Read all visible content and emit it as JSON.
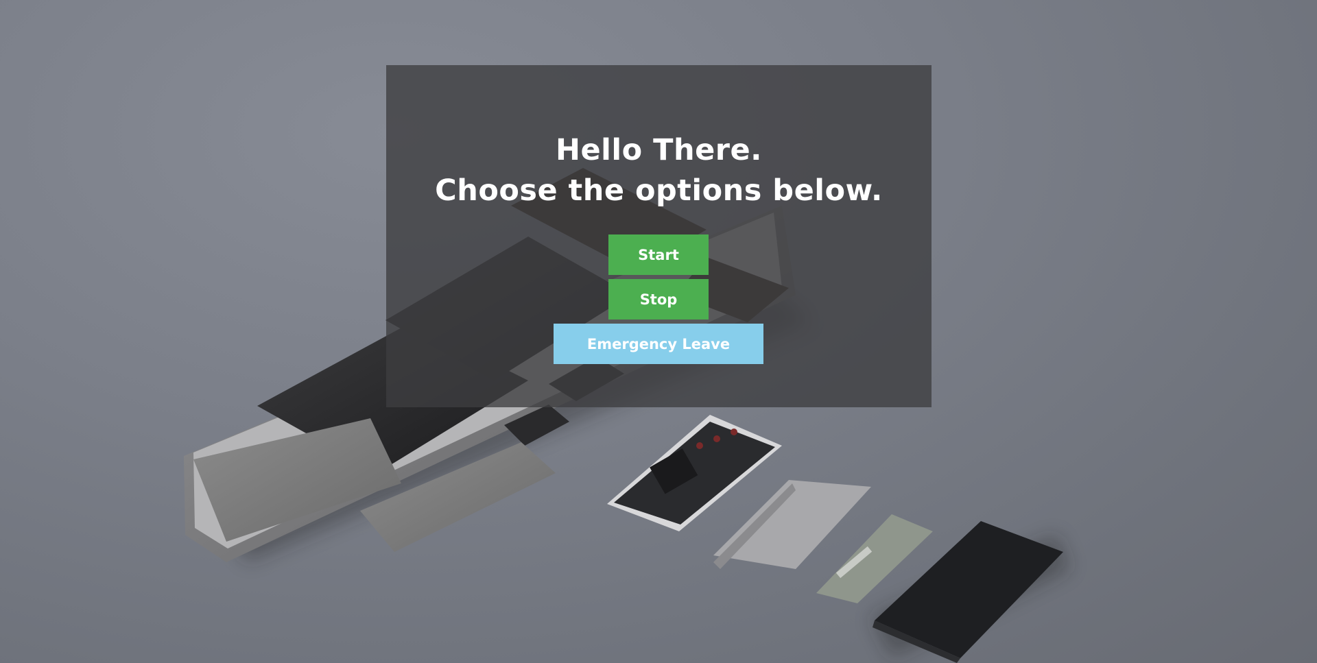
{
  "dialog": {
    "heading_line1": "Hello There.",
    "heading_line2": "Choose the options below."
  },
  "buttons": {
    "start_label": "Start",
    "stop_label": "Stop",
    "emergency_label": "Emergency Leave"
  },
  "colors": {
    "primary_button": "#4caf50",
    "emergency_button": "#87ceeb",
    "panel_overlay": "#3e3e40"
  },
  "background": {
    "icon": "modular-phone-photo"
  }
}
